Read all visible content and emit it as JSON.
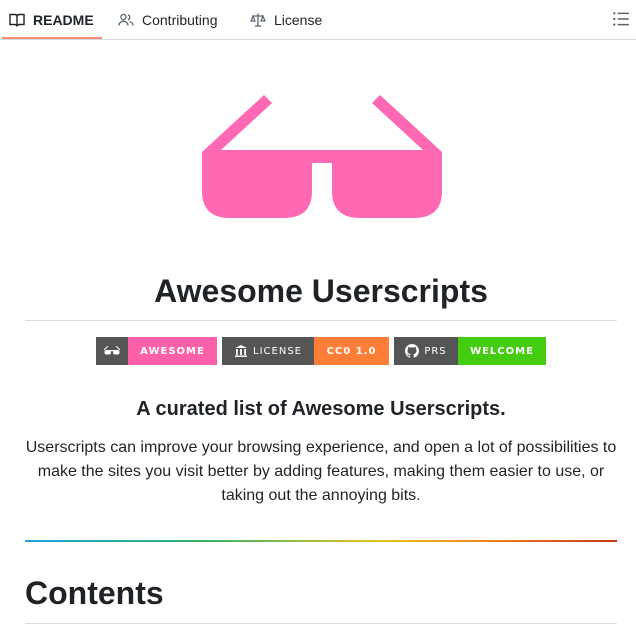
{
  "tabs": {
    "readme": "README",
    "contributing": "Contributing",
    "license": "License"
  },
  "colors": {
    "accent_underline": "#fd8c73",
    "glasses_pink": "#ff69b4"
  },
  "hero": {
    "icon": "sunglasses-icon"
  },
  "main": {
    "title": "Awesome Userscripts",
    "subtitle": "A curated list of Awesome Userscripts.",
    "description": "Userscripts can improve your browsing experience, and open a lot of possibilities to make the sites you visit better by adding features, making them easier to use, or taking out the annoying bits.",
    "contents_heading": "Contents"
  },
  "badges": [
    {
      "left_icon": "sunglasses-icon",
      "left_text": "",
      "right_text": "AWESOME",
      "color": "#fc60a8"
    },
    {
      "left_icon": "institution-icon",
      "left_text": "LICENSE",
      "right_text": "CC0 1.0",
      "color": "#fe7d37"
    },
    {
      "left_icon": "github-icon",
      "left_text": "PRS",
      "right_text": "WELCOME",
      "color": "#4c1"
    }
  ]
}
